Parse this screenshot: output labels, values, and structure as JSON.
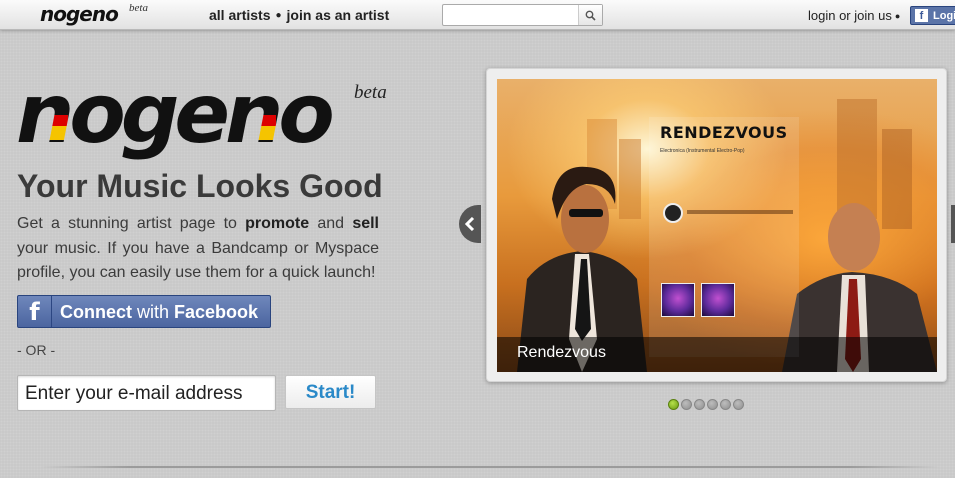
{
  "topbar": {
    "logo": "nogeno",
    "beta": "beta",
    "nav": [
      "all artists",
      "join as an artist"
    ],
    "search": {
      "placeholder": "",
      "icon": "search-icon"
    },
    "links": [
      "login or join us"
    ],
    "fb_login_label": "Login"
  },
  "hero": {
    "logo": "nogeno",
    "beta": "beta",
    "headline": "Your Music Looks Good",
    "intro": {
      "p1": "Get a stunning artist page to ",
      "b1": "promote",
      "p2": " and ",
      "b2": "sell",
      "p3": " your music. If you have a Bandcamp or Myspace profile, you can easily use them for a quick launch!"
    },
    "facebook_button": {
      "icon": "f",
      "connect": "Connect",
      "with": " with ",
      "facebook": "Facebook"
    },
    "or": "- OR -",
    "email": {
      "placeholder": "Enter your e-mail address",
      "value": ""
    },
    "start_label": "Start!"
  },
  "slider": {
    "slide": {
      "artist": "RENDEZVOUS",
      "genre": "Electronica (Instrumental Electro-Pop)",
      "caption": "Rendezvous"
    },
    "dot_count": 6,
    "active_dot": 0,
    "colors": {
      "active_dot": "#8bbf1e",
      "inactive_dot": "#9a9a9a"
    }
  },
  "colors": {
    "background": "#c9c9c9",
    "facebook": "#4b65a0",
    "start_text": "#2a89c8"
  }
}
